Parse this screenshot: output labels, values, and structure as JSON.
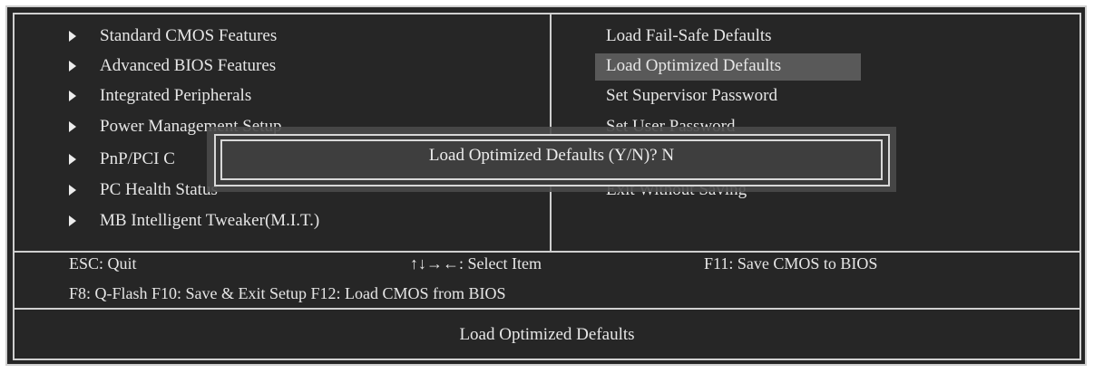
{
  "left_menu": {
    "items": [
      {
        "label": "Standard CMOS Features"
      },
      {
        "label": "Advanced BIOS Features"
      },
      {
        "label": "Integrated Peripherals"
      },
      {
        "label": "Power Management Setup"
      },
      {
        "label": "PnP/PCI C"
      },
      {
        "label": "PC Health Status"
      },
      {
        "label": "MB Intelligent Tweaker(M.I.T.)"
      }
    ]
  },
  "right_menu": {
    "items": [
      {
        "label": "Load Fail-Safe Defaults"
      },
      {
        "label": "Load Optimized Defaults"
      },
      {
        "label": "Set Supervisor Password"
      },
      {
        "label": "Set User Password"
      },
      {
        "label": "Exit Without Saving"
      }
    ],
    "selected": "Load Optimized Defaults"
  },
  "dialog": {
    "prompt": "Load Optimized Defaults (Y/N)? N"
  },
  "help_bar": {
    "esc": "ESC: Quit",
    "select": "↑↓→←: Select Item",
    "f11": "F11: Save CMOS to BIOS",
    "line2": "F8: Q-Flash F10: Save & Exit Setup F12: Load CMOS from BIOS"
  },
  "status_bar": {
    "text": "Load Optimized Defaults"
  },
  "colors": {
    "background": "#262626",
    "border": "#cfcfcf",
    "text": "#e6e6e6",
    "highlight": "#595959"
  }
}
